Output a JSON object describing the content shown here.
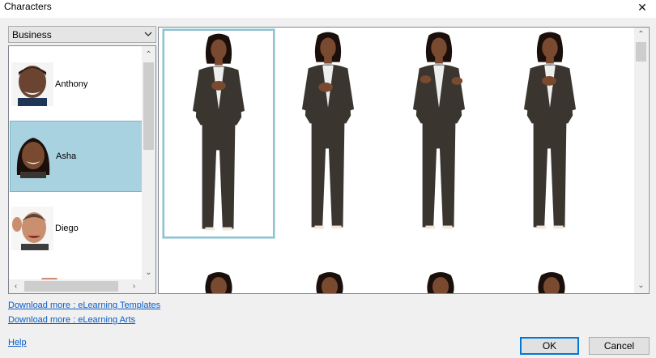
{
  "window": {
    "title": "Characters",
    "close_glyph": "✕"
  },
  "category": {
    "selected": "Business"
  },
  "characters": [
    {
      "name": "Anthony",
      "selected": false,
      "skin": "#6a4331"
    },
    {
      "name": "Asha",
      "selected": true,
      "skin": "#7a4a30"
    },
    {
      "name": "Diego",
      "selected": false,
      "skin": "#c98f6e"
    }
  ],
  "poses": [
    {
      "label": "pose-1",
      "selected": true
    },
    {
      "label": "pose-2",
      "selected": false
    },
    {
      "label": "pose-3",
      "selected": false
    },
    {
      "label": "pose-4",
      "selected": false
    }
  ],
  "links": {
    "templates": "Download more : eLearning Templates",
    "arts": "Download more : eLearning Arts",
    "help": "Help"
  },
  "buttons": {
    "ok": "OK",
    "cancel": "Cancel"
  },
  "colors": {
    "accent": "#0078d7",
    "selection": "#a8d2e0",
    "link": "#0a5bc4",
    "suit": "#3b3530"
  },
  "icons": [
    "close-icon",
    "chevron-down-icon",
    "scroll-up-icon",
    "scroll-down-icon",
    "scroll-left-icon",
    "scroll-right-icon"
  ]
}
